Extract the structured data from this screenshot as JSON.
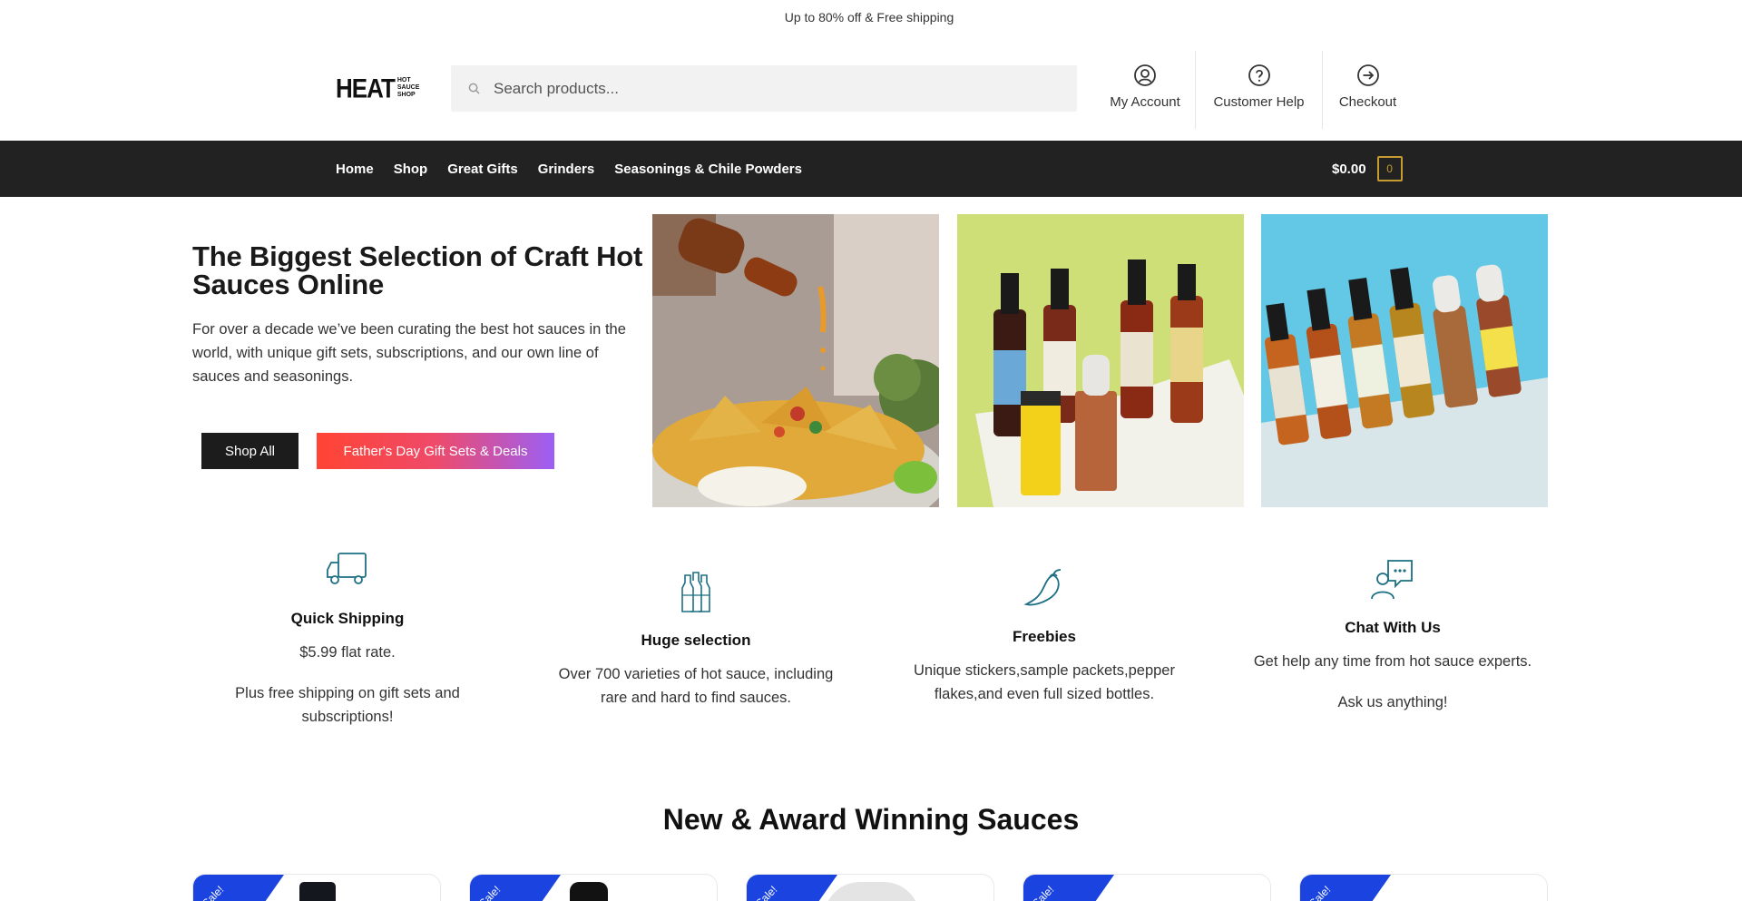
{
  "promo": {
    "text": "Up to 80% off & Free shipping"
  },
  "header": {
    "logo_text": "HEAT",
    "logo_sub_1": "HOT",
    "logo_sub_2": "SAUCE",
    "logo_sub_3": "SHOP",
    "search_placeholder": "Search products...",
    "links": [
      {
        "label": "My Account",
        "icon": "user-circle-icon"
      },
      {
        "label": "Customer Help",
        "icon": "question-circle-icon"
      },
      {
        "label": "Checkout",
        "icon": "arrow-circle-right-icon"
      }
    ]
  },
  "nav": {
    "items": [
      "Home",
      "Shop",
      "Great Gifts",
      "Grinders",
      "Seasonings & Chile Powders"
    ],
    "cart_amount": "$0.00",
    "cart_count": "0"
  },
  "hero": {
    "title": "The Biggest Selection of Craft Hot Sauces Online",
    "text": "For over a decade we’ve been curating the best hot sauces in the world, with unique gift sets, subscriptions, and our own line of sauces and seasonings.",
    "btn_shop_all": "Shop All",
    "btn_fathers": "Father's Day Gift Sets & Deals"
  },
  "features": [
    {
      "icon": "truck-icon",
      "title": "Quick Shipping",
      "lines": [
        "$5.99 flat rate.",
        "Plus free shipping on gift sets and subscriptions!"
      ]
    },
    {
      "icon": "bottles-icon",
      "title": "Huge selection",
      "lines": [
        "Over 700 varieties of hot sauce, including rare and hard to find sauces."
      ]
    },
    {
      "icon": "chili-pepper-icon",
      "title": "Freebies",
      "lines": [
        "Unique stickers,sample packets,pepper flakes,and even full sized bottles."
      ]
    },
    {
      "icon": "chat-person-icon",
      "title": "Chat With Us",
      "lines": [
        "Get help any time from hot sauce experts.",
        "Ask us anything!"
      ]
    }
  ],
  "section": {
    "title": "New & Award Winning Sauces"
  },
  "products": [
    {
      "badge": "Sale!"
    },
    {
      "badge": "Sale!"
    },
    {
      "badge": "Sale!"
    },
    {
      "badge": "Sale!"
    },
    {
      "badge": "Sale!"
    }
  ],
  "colors": {
    "nav_bg": "#222222",
    "cart_accent": "#c59b32",
    "sale_ribbon": "#1a43e0",
    "feature_icon": "#1d6f84",
    "button_gradient_start": "#ff4433",
    "button_gradient_end": "#9c5ff5"
  }
}
